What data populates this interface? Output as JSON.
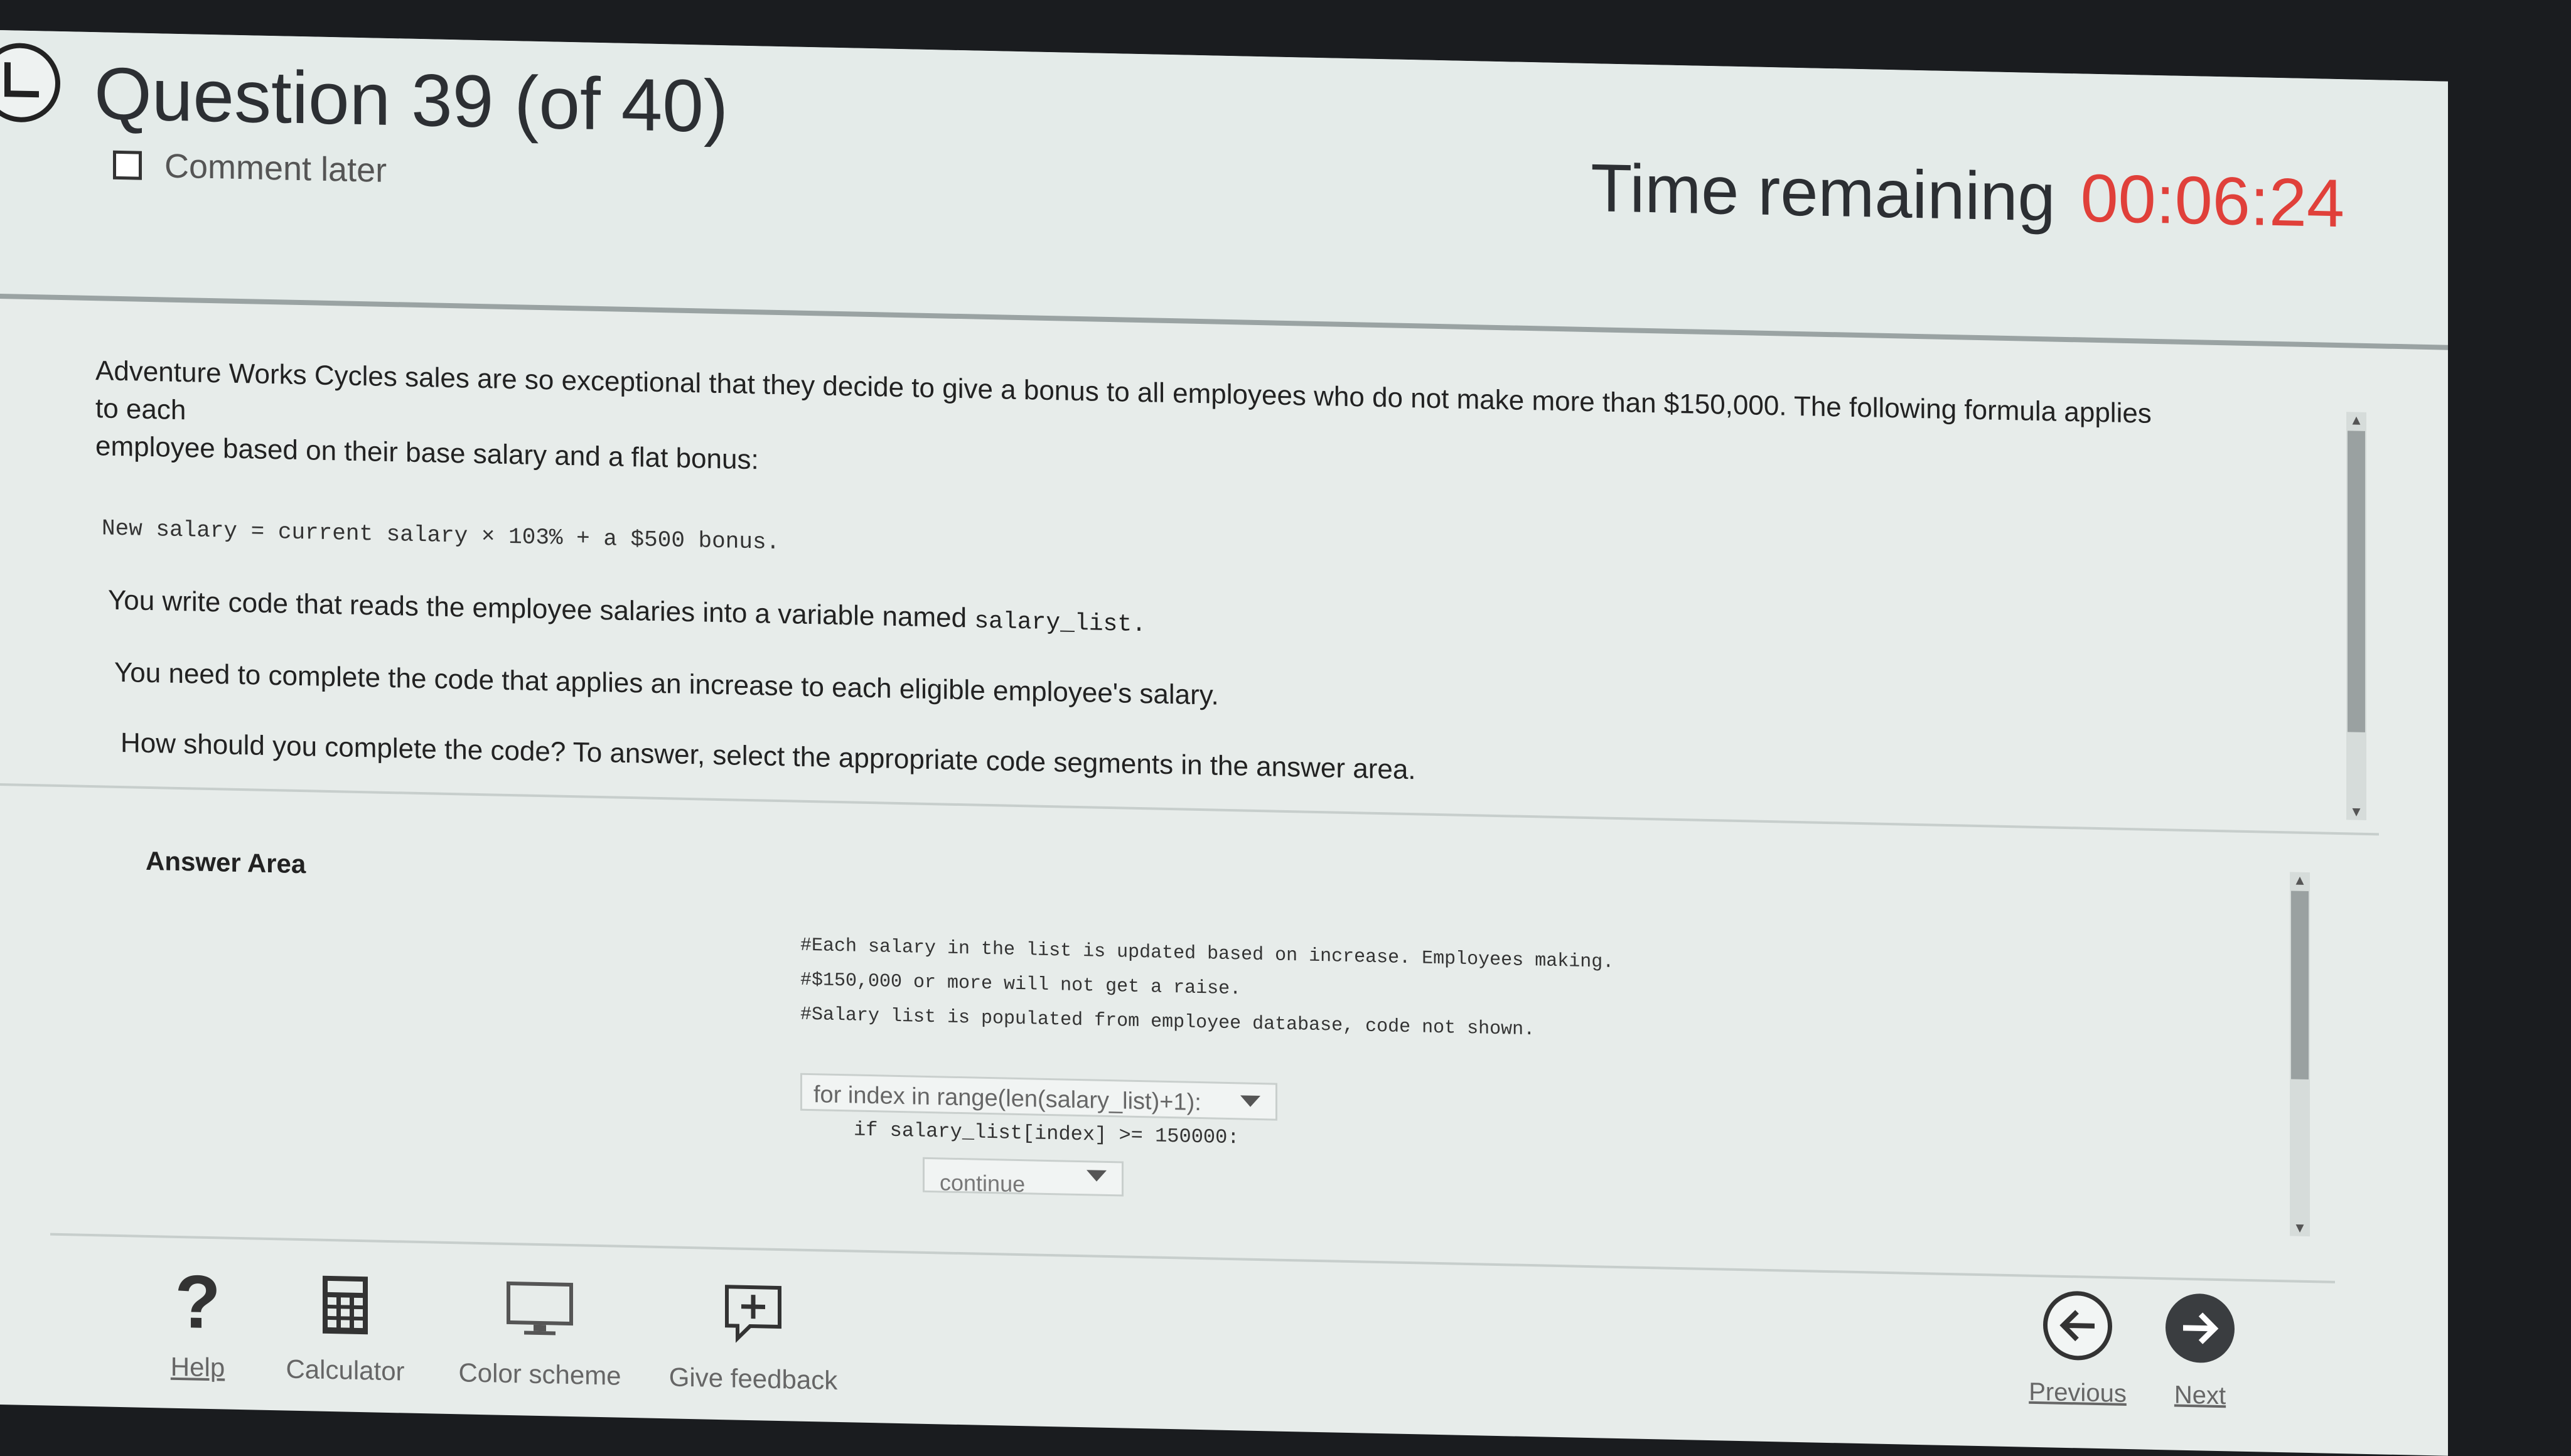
{
  "header": {
    "question_title": "Question 39 (of 40)",
    "comment_later_label": "Comment later",
    "time_label": "Time remaining",
    "time_value": "00:06:24"
  },
  "question": {
    "paragraph1_line1": "Adventure Works Cycles sales are so exceptional that they decide to give a bonus to all employees who do not make more than $150,000. The following formula applies to each",
    "paragraph1_line2": "employee based on their base salary and a flat bonus:",
    "formula": "New salary = current salary × 103% + a $500 bonus.",
    "paragraph2_text": "You write code that reads the employee salaries into a variable named ",
    "paragraph2_code": "salary_list.",
    "paragraph3": "You need to complete the code that applies an increase to each eligible employee's salary.",
    "paragraph4": "How should you complete the code? To answer, select the appropriate code segments in the answer area."
  },
  "answer": {
    "title": "Answer Area",
    "comment1": "#Each salary in the list is updated based on increase. Employees making.",
    "comment2": "#$150,000 or more will not get a raise.",
    "comment3": "#Salary list is populated from employee database, code not shown.",
    "dropdown1_value": "for index in range(len(salary_list)+1):",
    "code_line": "if salary_list[index] >= 150000:",
    "dropdown2_value": "continue"
  },
  "toolbar": {
    "help_label": "Help",
    "calculator_label": "Calculator",
    "color_scheme_label": "Color scheme",
    "give_feedback_label": "Give feedback",
    "previous_label": "Previous",
    "next_label": "Next"
  },
  "colors": {
    "timer_value": "#e0403a",
    "next_button": "#3a3d40"
  }
}
